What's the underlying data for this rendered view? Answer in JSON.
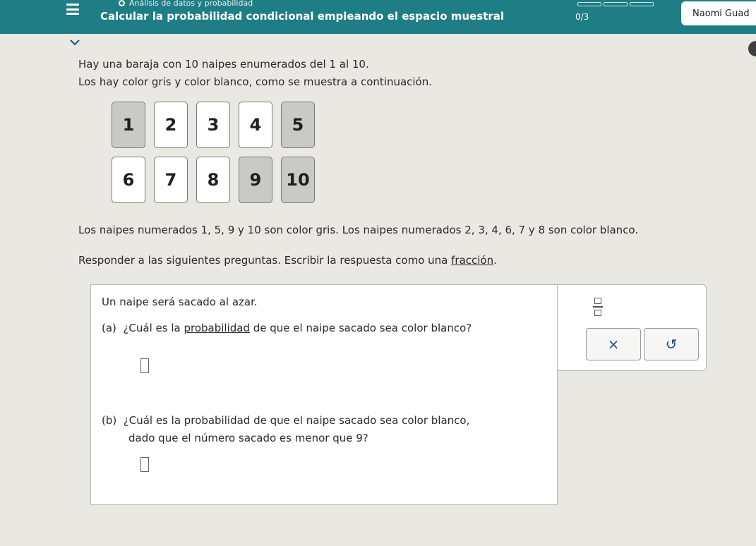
{
  "header": {
    "breadcrumb": "Análisis de datos y probabilidad",
    "title": "Calcular la probabilidad condicional empleando el espacio muestral",
    "progress": "0/3",
    "user_name": "Naomi Guad"
  },
  "intro": {
    "line1": "Hay una baraja con 10 naipes enumerados del 1 al 10.",
    "line2": "Los hay color gris y color blanco, como se muestra a continuación."
  },
  "cards": [
    {
      "number": "1",
      "color": "gris"
    },
    {
      "number": "2",
      "color": "blanco"
    },
    {
      "number": "3",
      "color": "blanco"
    },
    {
      "number": "4",
      "color": "blanco"
    },
    {
      "number": "5",
      "color": "gris"
    },
    {
      "number": "6",
      "color": "blanco"
    },
    {
      "number": "7",
      "color": "blanco"
    },
    {
      "number": "8",
      "color": "blanco"
    },
    {
      "number": "9",
      "color": "gris"
    },
    {
      "number": "10",
      "color": "gris"
    }
  ],
  "colors_note": "Los naipes numerados 1, 5, 9 y 10 son color gris. Los naipes numerados 2, 3, 4, 6, 7 y 8 son color blanco.",
  "instructions": {
    "before": "Responder a las siguientes preguntas. Escribir la respuesta como una ",
    "link": "fracción",
    "after": "."
  },
  "question": {
    "intro": "Un naipe será sacado al azar.",
    "a_label": "(a)",
    "a_before": "¿Cuál es la ",
    "a_link": "probabilidad",
    "a_after": " de que el naipe sacado sea color blanco?",
    "b_label": "(b)",
    "b_line1": "¿Cuál es la probabilidad de que el naipe sacado sea color blanco,",
    "b_line2": "dado que el número sacado es menor que 9?"
  },
  "tools": {
    "fraction_icon": "fraction-icon",
    "clear_label": "×",
    "undo_label": "↺"
  },
  "colors": {
    "header": "#1f7d86",
    "gray_card": "#c9c9c6",
    "white_card": "#ffffff"
  }
}
